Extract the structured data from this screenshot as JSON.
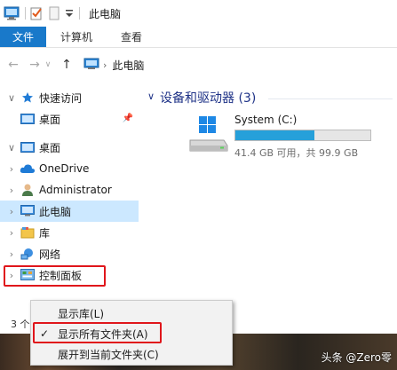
{
  "window": {
    "title": "此电脑"
  },
  "ribbon": {
    "tabs": [
      "文件",
      "计算机",
      "查看"
    ]
  },
  "address": {
    "location": "此电脑"
  },
  "nav": {
    "items": [
      {
        "label": "快速访问",
        "icon": "star-icon"
      },
      {
        "label": "桌面",
        "icon": "desktop-icon"
      },
      {
        "label": "桌面",
        "icon": "desktop-icon"
      },
      {
        "label": "OneDrive",
        "icon": "cloud-icon"
      },
      {
        "label": "Administrator",
        "icon": "user-icon"
      },
      {
        "label": "此电脑",
        "icon": "computer-icon"
      },
      {
        "label": "库",
        "icon": "library-icon"
      },
      {
        "label": "网络",
        "icon": "network-icon"
      },
      {
        "label": "控制面板",
        "icon": "control-panel-icon"
      }
    ]
  },
  "content": {
    "group_header": "设备和驱动器 (3)",
    "drive": {
      "name": "System (C:)",
      "used_fraction": 0.585,
      "info": "41.4 GB 可用，共 99.9 GB"
    }
  },
  "statusbar": {
    "text": "3 个"
  },
  "context_menu": {
    "items": [
      {
        "label": "显示库(L)",
        "checked": false
      },
      {
        "label": "显示所有文件夹(A)",
        "checked": true
      },
      {
        "label": "展开到当前文件夹(C)",
        "checked": false
      }
    ]
  },
  "watermark": "头条 @Zero零",
  "colors": {
    "accent": "#1979ca",
    "selection": "#cce8ff",
    "highlight": "#e0161b",
    "drive_fill": "#26a0da"
  }
}
